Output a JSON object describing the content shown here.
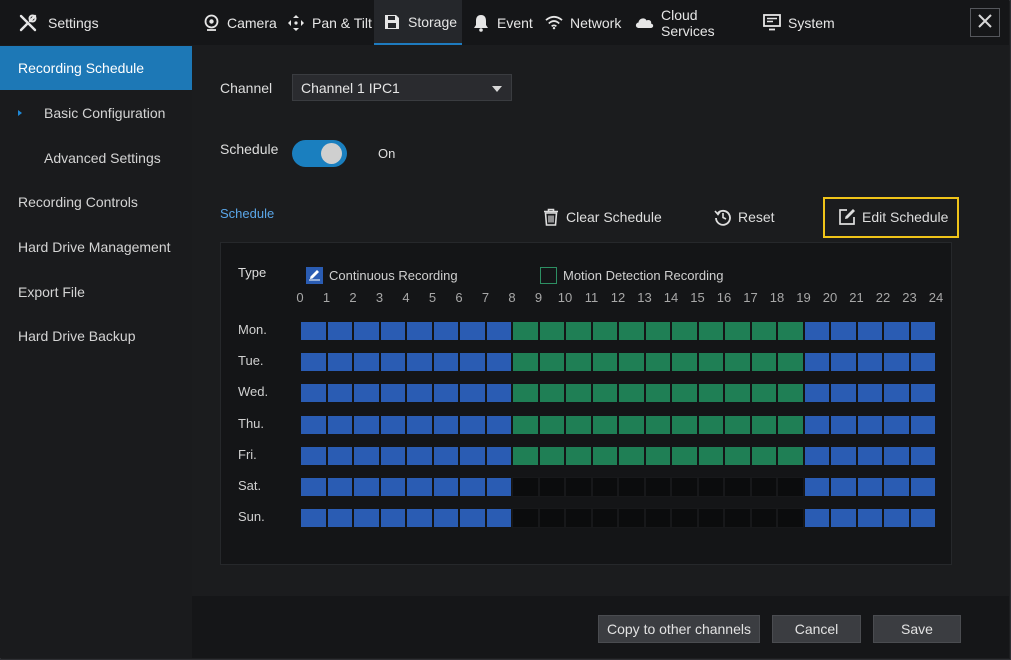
{
  "header": {
    "app_title": "Settings",
    "tabs": [
      {
        "label": "Camera",
        "icon": "camera-icon"
      },
      {
        "label": "Pan & Tilt",
        "icon": "move-arrows-icon"
      },
      {
        "label": "Storage",
        "icon": "floppy-disk-icon",
        "active": true
      },
      {
        "label": "Event",
        "icon": "bell-icon"
      },
      {
        "label": "Network",
        "icon": "wifi-icon"
      },
      {
        "label": "Cloud Services",
        "icon": "cloud-icon"
      },
      {
        "label": "System",
        "icon": "monitor-icon"
      }
    ]
  },
  "sidebar": {
    "items": [
      {
        "label": "Recording Schedule",
        "active": true
      },
      {
        "label": "Basic Configuration",
        "sub": true,
        "selected": true
      },
      {
        "label": "Advanced Settings",
        "sub": true
      },
      {
        "label": "Recording Controls"
      },
      {
        "label": "Hard Drive Management"
      },
      {
        "label": "Export File"
      },
      {
        "label": "Hard Drive Backup"
      }
    ]
  },
  "form": {
    "channel_label": "Channel",
    "channel_value": "Channel 1 IPC1",
    "schedule_label": "Schedule",
    "schedule_state": "On"
  },
  "schedule": {
    "section_label": "Schedule",
    "clear_label": "Clear Schedule",
    "reset_label": "Reset",
    "edit_label": "Edit Schedule",
    "type_label": "Type",
    "legend": {
      "continuous": "Continuous Recording",
      "motion": "Motion Detection Recording"
    },
    "hours": [
      "0",
      "1",
      "2",
      "3",
      "4",
      "5",
      "6",
      "7",
      "8",
      "9",
      "10",
      "11",
      "12",
      "13",
      "14",
      "15",
      "16",
      "17",
      "18",
      "19",
      "20",
      "21",
      "22",
      "23",
      "24"
    ],
    "days": [
      {
        "label": "Mon.",
        "pattern": "CCCCCCCCMMMMMMMMMMMCCCCC"
      },
      {
        "label": "Tue.",
        "pattern": "CCCCCCCCMMMMMMMMMMMCCCCC"
      },
      {
        "label": "Wed.",
        "pattern": "CCCCCCCCMMMMMMMMMMMCCCCC"
      },
      {
        "label": "Thu.",
        "pattern": "CCCCCCCCMMMMMMMMMMMCCCCC"
      },
      {
        "label": "Fri.",
        "pattern": "CCCCCCCCMMMMMMMMMMMCCCCC"
      },
      {
        "label": "Sat.",
        "pattern": "CCCCCCCCNNNNNNNNNNNCCCCC"
      },
      {
        "label": "Sun.",
        "pattern": "CCCCCCCCNNNNNNNNNNNCCCCC"
      }
    ],
    "colors": {
      "continuous": "#2a5cb3",
      "motion": "#1f7f55",
      "none": "#0b0c0d"
    }
  },
  "footer": {
    "copy_label": "Copy to other channels",
    "cancel_label": "Cancel",
    "save_label": "Save"
  },
  "colors": {
    "accent": "#1d78b6",
    "highlight": "#f0c419"
  }
}
